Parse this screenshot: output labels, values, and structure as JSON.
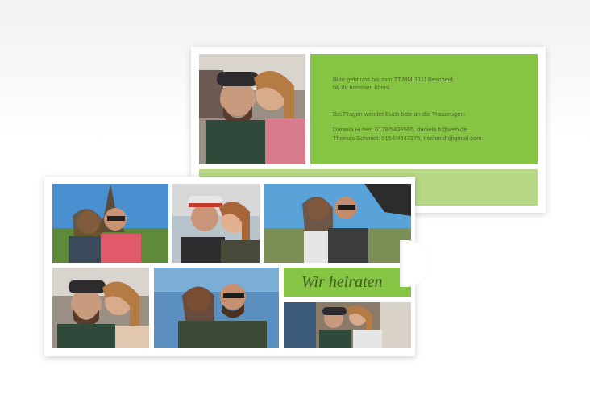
{
  "rsvp": {
    "line1": "Bitte gebt uns bis zum TT.MM.JJJJ Bescheid,",
    "line2": "ob ihr kommen könnt.",
    "line3": "Bei Fragen wendet Euch bitte an die Trauzeugen:",
    "contact1": "Daniela Huber: 0178/5436565, daniela.h@web.de",
    "contact2": "Thomas Schmidt: 0154/4847376, t.schmidt@gmail.com"
  },
  "headline": "Wir heiraten",
  "colors": {
    "primary_green": "#86c443",
    "light_green": "#b6d885",
    "text_green": "#4a6a25"
  }
}
